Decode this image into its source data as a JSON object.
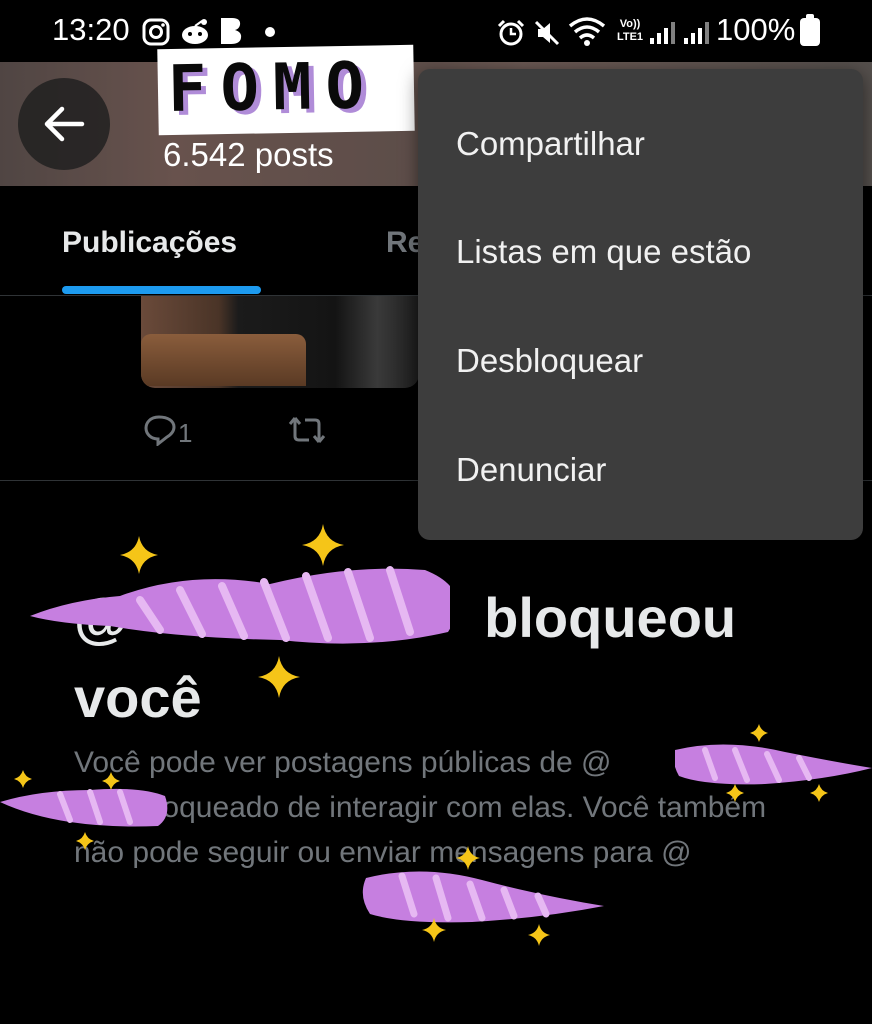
{
  "status_bar": {
    "time": "13:20",
    "battery": "100%",
    "volte_top": "Vo))",
    "volte_bottom": "LTE1",
    "icons": [
      "instagram-icon",
      "reddit-icon",
      "b-app-icon",
      "dot-icon",
      "alarm-icon",
      "mute-icon",
      "wifi-icon",
      "volte-icon",
      "signal-icon",
      "signal-icon",
      "battery-icon"
    ]
  },
  "header": {
    "sticker_text": "FOMO",
    "posts_count": "6.542 posts"
  },
  "tabs": [
    {
      "label": "Publicações",
      "active": true
    },
    {
      "label": "Re",
      "active": false
    }
  ],
  "post": {
    "reply_count": "1"
  },
  "blocked_notice": {
    "title_prefix": "@",
    "title_suffix": " bloqueou",
    "title_line2": "você",
    "desc_part1": "Você pode ver postagens públicas de @",
    "desc_part2": ", mas está bloqueado de interagir com elas. Você também não pode seguir ou enviar mensagens para @"
  },
  "menu": {
    "items": [
      {
        "label": "Compartilhar"
      },
      {
        "label": "Listas em que estão"
      },
      {
        "label": "Desbloquear"
      },
      {
        "label": "Denunciar"
      }
    ]
  },
  "colors": {
    "accent": "#1d9bf0",
    "menu_bg": "#3d3d3d",
    "sticker_purple": "#c17fe0",
    "star_yellow": "#f5c518"
  }
}
